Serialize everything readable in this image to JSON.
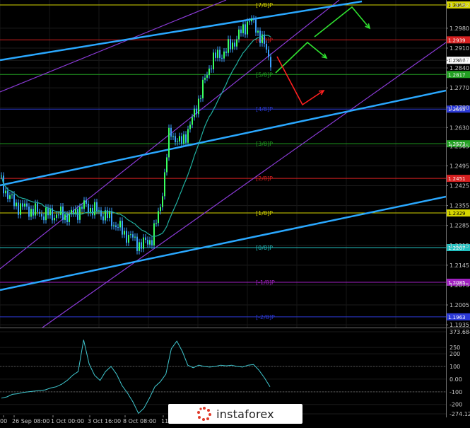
{
  "chart_data": [
    {
      "type": "candlestick",
      "symbol": "GBP/USD",
      "ylim": [
        1.19,
        1.31
      ],
      "y_ticks": [
        "1.3062",
        "1.2980",
        "1.2910",
        "1.2867",
        "1.2840",
        "1.2770",
        "1.2700",
        "1.2630",
        "1.2565",
        "1.2495",
        "1.2425",
        "1.2355",
        "1.2285",
        "1.2215",
        "1.2145",
        "1.2075",
        "1.2005",
        "1.1935"
      ],
      "x_ticks": [
        "00",
        "26 Sep 08:00",
        "1 Oct 00:00",
        "3 Oct 16:00",
        "8 Oct 08:00",
        "11 Oct"
      ],
      "murray_levels": [
        {
          "label": "[7/8]P",
          "price": "1.3062",
          "value": 1.3062,
          "color": "#d6d600"
        },
        {
          "label": "[6/8]P",
          "price": "1.2939",
          "value": 1.2939,
          "color": "#d62020"
        },
        {
          "label": "[5/8]P",
          "price": "1.2817",
          "value": 1.2817,
          "color": "#22a022"
        },
        {
          "label": "[4/8]P",
          "price": "1.2695",
          "value": 1.2695,
          "color": "#2c3ad6"
        },
        {
          "label": "[3/8]P",
          "price": "1.2573",
          "value": 1.2573,
          "color": "#22a022"
        },
        {
          "label": "[2/8]P",
          "price": "1.2451",
          "value": 1.2451,
          "color": "#d62020"
        },
        {
          "label": "[1/8]P",
          "price": "1.2329",
          "value": 1.2329,
          "color": "#d6d600"
        },
        {
          "label": "[0/8]P",
          "price": "1.2207",
          "value": 1.2207,
          "color": "#22c0c0"
        },
        {
          "label": "[-1/8]P",
          "price": "1.2085",
          "value": 1.2085,
          "color": "#a020c0"
        },
        {
          "label": "[-2/8]P",
          "price": "1.1963",
          "value": 1.1963,
          "color": "#2c3ad6"
        }
      ],
      "current_price": "1.2867",
      "ma_color": "#20b0a0",
      "candle_color": "#3aa0ff",
      "channel_color": "#8a3ad6",
      "trend_color": "#2aa8ff"
    },
    {
      "type": "line",
      "name": "CCI",
      "ylim": [
        -274.124,
        373.6844
      ],
      "y_ticks": [
        "373.6844",
        "250",
        "200",
        "100",
        "0.00",
        "-100",
        "-200",
        "-274.124"
      ],
      "values": [
        -150,
        -140,
        -120,
        -115,
        -105,
        -100,
        -95,
        -90,
        -85,
        -70,
        -60,
        -40,
        -10,
        30,
        60,
        310,
        120,
        30,
        -10,
        60,
        100,
        40,
        -50,
        -110,
        -180,
        -270,
        -230,
        -150,
        -60,
        -20,
        40,
        240,
        300,
        220,
        110,
        90,
        110,
        100,
        95,
        100,
        110,
        105,
        110,
        100,
        95,
        110,
        115,
        70,
        10,
        -60
      ],
      "line_color": "#40c8d0"
    }
  ],
  "watermark": {
    "text": "instaforex"
  }
}
